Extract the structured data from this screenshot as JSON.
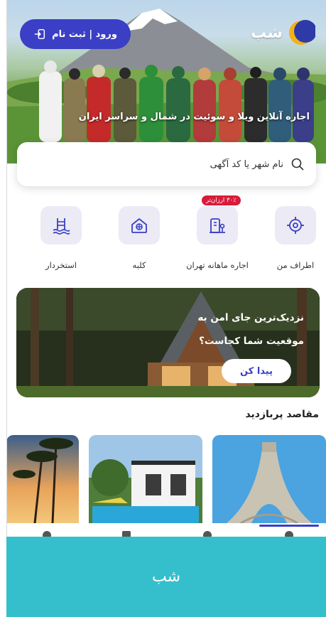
{
  "header": {
    "login_label": "ورود | ثبت نام",
    "logo_text": "شب",
    "tagline": "اجاره آنلاین ویلا و سوئیت در شمال و سراسر ایران"
  },
  "search": {
    "placeholder": "نام شهر یا کد آگهی"
  },
  "categories": [
    {
      "label": "اطراف من",
      "icon": "location-target-icon"
    },
    {
      "label": "اجاره ماهانه تهران",
      "icon": "building-icon",
      "badge": "۳۰٪ ارزان‌تر"
    },
    {
      "label": "کلبه",
      "icon": "cabin-icon"
    },
    {
      "label": "استخردار",
      "icon": "pool-icon"
    }
  ],
  "promo": {
    "text": "نزدیک‌ترین جای امن به موقعیت شما کجاست؟",
    "button_label": "پیدا کن"
  },
  "destinations": {
    "title": "مقاصد پربازدید",
    "items": [
      {
        "icon": "azadi-tower-image"
      },
      {
        "icon": "villa-pool-image"
      },
      {
        "icon": "palm-beach-image"
      }
    ]
  },
  "bottom_bar": {
    "label": "شب"
  },
  "colors": {
    "brand": "#3a3fc6",
    "badge": "#d81b3a",
    "bottom_bar": "#35bfcc"
  }
}
